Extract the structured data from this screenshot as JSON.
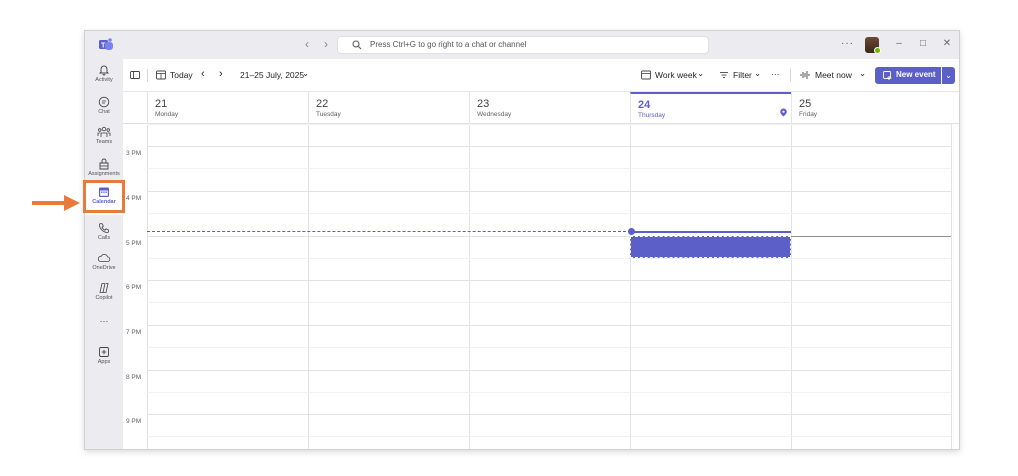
{
  "search": {
    "placeholder": "Press Ctrl+G to go right to a chat or channel"
  },
  "window": {
    "more": "···",
    "minimize": "–",
    "maximize": "□",
    "close": "✕",
    "back": "‹",
    "forward": "›"
  },
  "rail": {
    "items": [
      {
        "label": "Activity",
        "icon": "bell-icon"
      },
      {
        "label": "Chat",
        "icon": "chat-icon"
      },
      {
        "label": "Teams",
        "icon": "teams-icon"
      },
      {
        "label": "Assignments",
        "icon": "assignments-icon"
      },
      {
        "label": "Calendar",
        "icon": "calendar-icon"
      },
      {
        "label": "Calls",
        "icon": "phone-icon"
      },
      {
        "label": "OneDrive",
        "icon": "cloud-icon"
      },
      {
        "label": "Copilot",
        "icon": "copilot-icon"
      },
      {
        "label": "···",
        "icon": "more-icon"
      },
      {
        "label": "Apps",
        "icon": "apps-icon"
      }
    ],
    "active": "Calendar"
  },
  "toolbar": {
    "today": "Today",
    "prev": "‹",
    "next": "›",
    "range": "21–25 July, 2025",
    "range_caret": "⌄",
    "view": "Work week",
    "view_caret": "⌄",
    "filter": "Filter",
    "filter_caret": "⌄",
    "more": "···",
    "meet_now": "Meet now",
    "meet_caret": "⌄",
    "new_event": "New event",
    "new_event_caret": "⌄"
  },
  "days": [
    {
      "num": "21",
      "name": "Monday"
    },
    {
      "num": "22",
      "name": "Tuesday"
    },
    {
      "num": "23",
      "name": "Wednesday"
    },
    {
      "num": "24",
      "name": "Thursday",
      "today": true
    },
    {
      "num": "25",
      "name": "Friday"
    }
  ],
  "hours": [
    "3 PM",
    "4 PM",
    "5 PM",
    "6 PM",
    "7 PM",
    "8 PM",
    "9 PM"
  ],
  "colors": {
    "accent": "#5b5fc7",
    "highlight": "#e87a3c"
  }
}
